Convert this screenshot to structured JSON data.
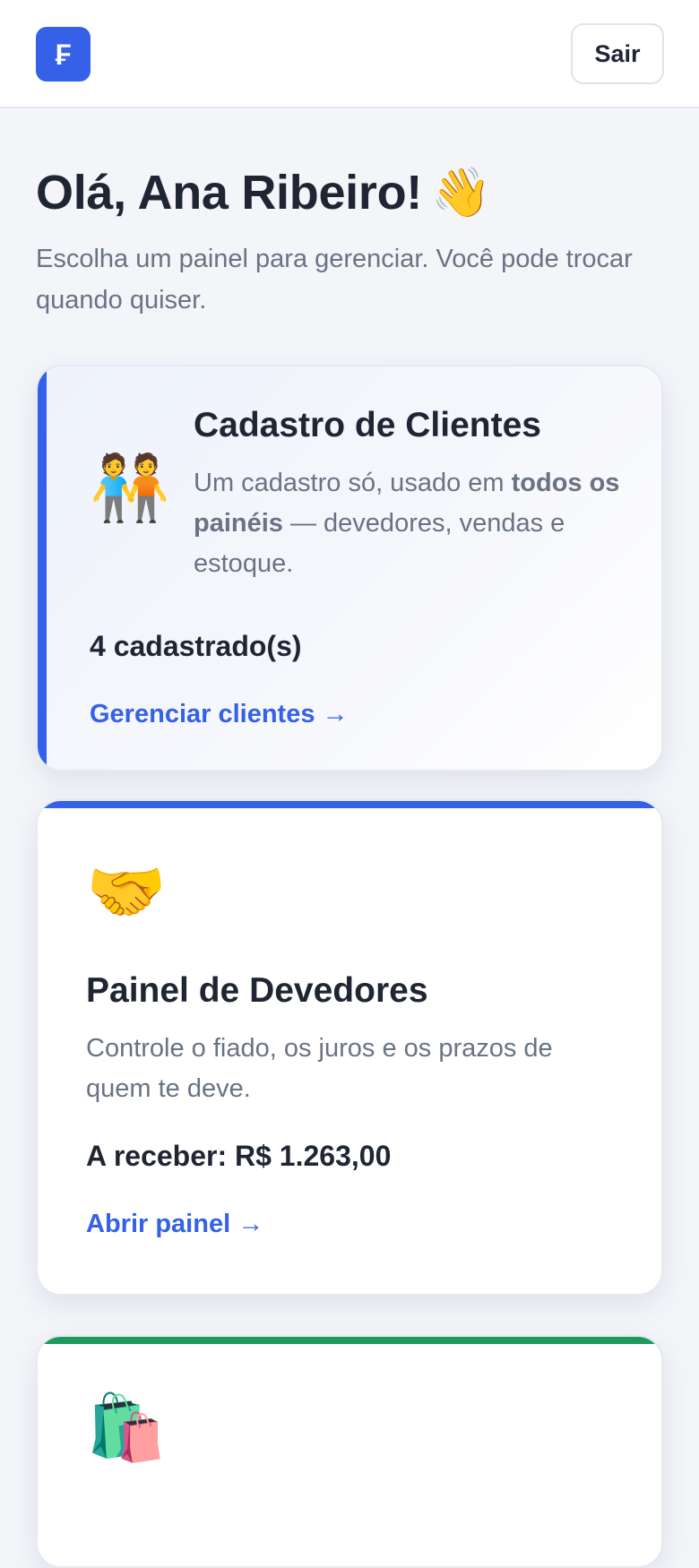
{
  "header": {
    "logo_glyph": "₣",
    "logout_label": "Sair"
  },
  "welcome": {
    "greeting": "Olá, Ana Ribeiro!",
    "wave_emoji": "👋",
    "subtitle": "Escolha um painel para gerenciar. Você pode trocar quando quiser."
  },
  "clients_card": {
    "icon": "people-holding-hands-icon",
    "icon_glyph": "🧑‍🤝‍🧑",
    "title": "Cadastro de Clientes",
    "desc_before": "Um cadastro só, usado em ",
    "desc_bold": "todos os painéis",
    "desc_after": " — devedores, vendas e estoque.",
    "count": "4 cadastrado(s)",
    "link": "Gerenciar clientes →",
    "accent_color": "#3461e8"
  },
  "panels": [
    {
      "icon": "handshake-icon",
      "icon_glyph": "🤝",
      "title": "Painel de Devedores",
      "description": "Controle o fiado, os juros e os prazos de quem te deve.",
      "amount": "A receber: R$ 1.263,00",
      "link": "Abrir painel →",
      "accent_color": "#3461e8"
    },
    {
      "icon": "shopping-bags-icon",
      "icon_glyph": "🛍️",
      "accent_color": "#1e9a5c"
    }
  ]
}
